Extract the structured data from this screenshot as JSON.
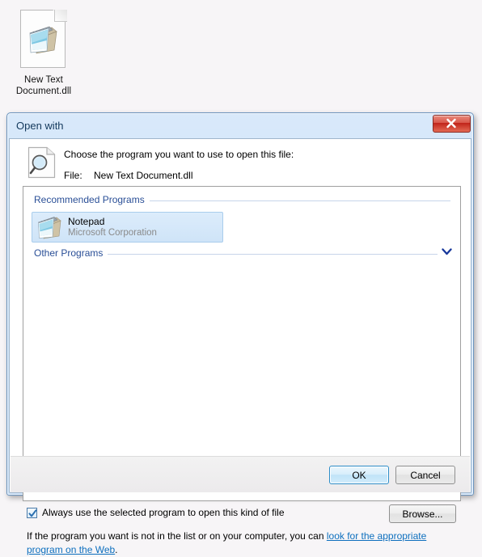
{
  "desktop": {
    "icon": {
      "name": "notepad-file-icon",
      "label_line1": "New Text",
      "label_line2": "Document.dll"
    }
  },
  "dialog": {
    "title": "Open with",
    "close_label": "x",
    "prompt": "Choose the program you want to use to open this file:",
    "file_label": "File:",
    "file_value": "New Text Document.dll",
    "groups": {
      "recommended": {
        "header": "Recommended Programs",
        "items": [
          {
            "name": "Notepad",
            "publisher": "Microsoft Corporation",
            "selected": true,
            "icon": "notepad-icon"
          }
        ]
      },
      "other": {
        "header": "Other Programs",
        "expander_icon": "chevron-down-icon",
        "items": []
      }
    },
    "always_use": {
      "label": "Always use the selected program to open this kind of file",
      "checked": true
    },
    "browse_label": "Browse...",
    "helper": {
      "prefix": "If the program you want is not in the list or on your computer, you can ",
      "link": "look for the appropriate program on the Web",
      "suffix": "."
    },
    "buttons": {
      "ok": "OK",
      "cancel": "Cancel"
    }
  },
  "colors": {
    "accent_blue": "#2a4f97",
    "link_blue": "#0d6fbe",
    "title_bar_blue": "#cfe3f8",
    "close_red": "#c1241a",
    "selection_blue": "#cfe4f8",
    "desktop_bg": "#f7f5f7"
  }
}
